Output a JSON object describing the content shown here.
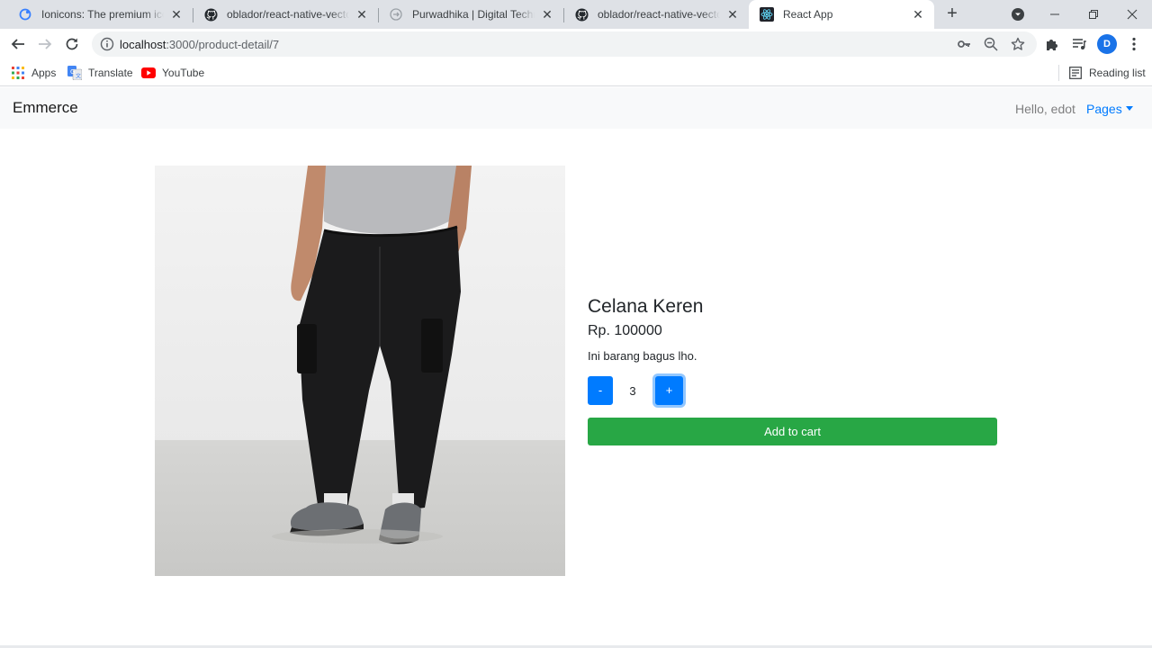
{
  "browser": {
    "tabs": [
      {
        "title": "Ionicons: The premium icon pack",
        "favicon": "ionicons-icon"
      },
      {
        "title": "oblador/react-native-vector-icons",
        "favicon": "github-icon"
      },
      {
        "title": "Purwadhika | Digital Technology School",
        "favicon": "purwadhika-icon"
      },
      {
        "title": "oblador/react-native-vector-icons",
        "favicon": "github-icon"
      },
      {
        "title": "React App",
        "favicon": "react-icon"
      }
    ],
    "address": {
      "host": "localhost",
      "path": ":3000/product-detail/7"
    },
    "profile_initial": "D",
    "bookmarks": [
      {
        "label": "Apps",
        "icon": "apps-grid-icon"
      },
      {
        "label": "Translate",
        "icon": "translate-icon"
      },
      {
        "label": "YouTube",
        "icon": "youtube-icon"
      }
    ],
    "reading_list": "Reading list"
  },
  "navbar": {
    "brand": "Emmerce",
    "greeting": "Hello, edot",
    "menu": "Pages"
  },
  "product": {
    "name": "Celana Keren",
    "price": "Rp. 100000",
    "description": "Ini barang bagus lho.",
    "quantity": "3",
    "decrement_label": "-",
    "increment_label": "+",
    "add_to_cart_label": "Add to cart"
  },
  "colors": {
    "primary": "#007bff",
    "success": "#28a745",
    "navbar_bg": "#f8f9fa"
  }
}
